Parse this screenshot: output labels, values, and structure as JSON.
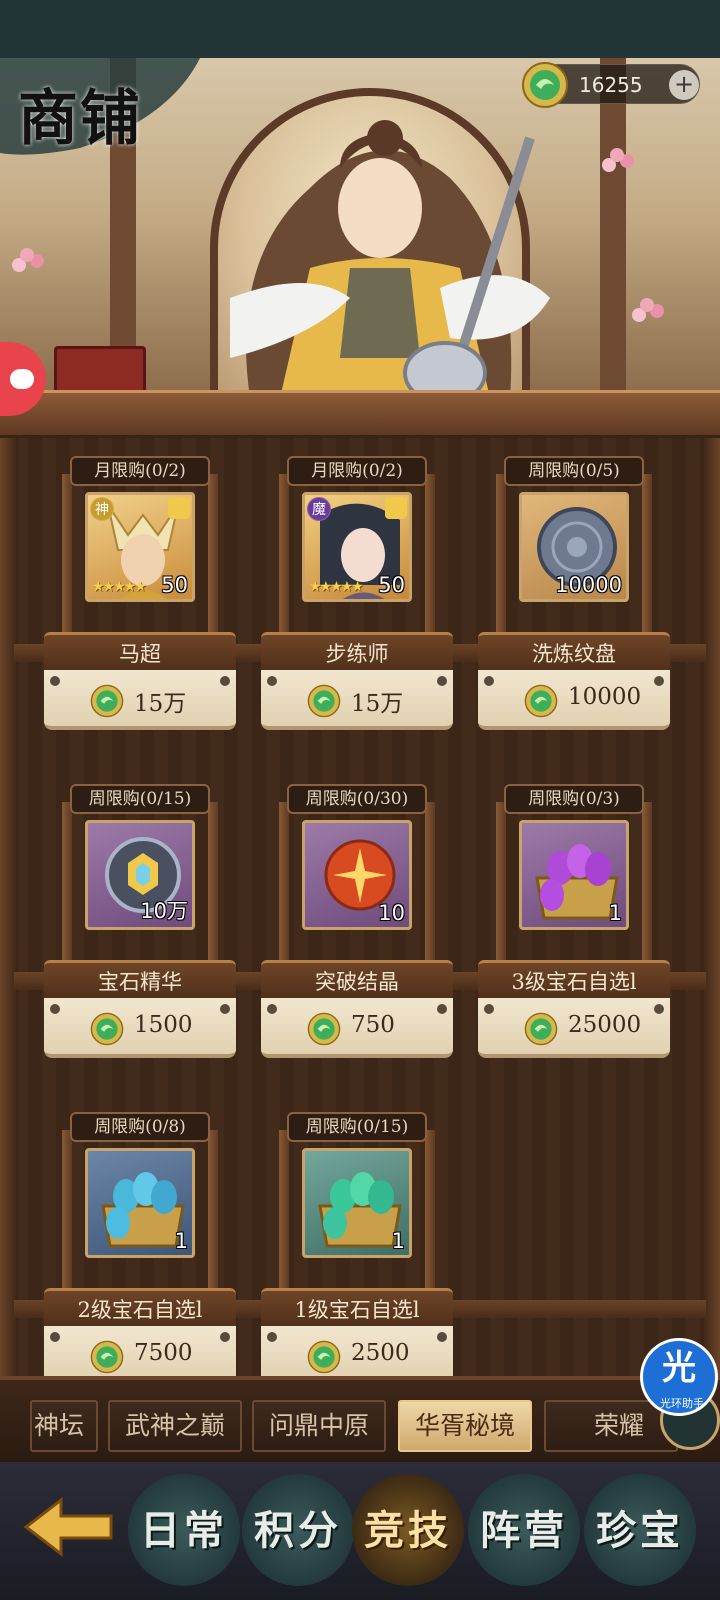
{
  "shop": {
    "title": "商铺"
  },
  "currency": {
    "amount": "16255",
    "icon": "jade-coin-icon"
  },
  "items": [
    {
      "limit": "月限购(0/2)",
      "name": "马超",
      "qty": "50",
      "price": "15万",
      "icon": "hero-ma-chao-portrait",
      "faction": "神"
    },
    {
      "limit": "月限购(0/2)",
      "name": "步练师",
      "qty": "50",
      "price": "15万",
      "icon": "hero-bu-lianshi-portrait",
      "faction": "魔"
    },
    {
      "limit": "周限购(0/5)",
      "name": "洗炼纹盘",
      "qty": "10000",
      "price": "10000",
      "icon": "refine-disc-icon"
    },
    {
      "limit": "周限购(0/15)",
      "name": "宝石精华",
      "qty": "10万",
      "price": "1500",
      "icon": "gem-essence-icon"
    },
    {
      "limit": "周限购(0/30)",
      "name": "突破结晶",
      "qty": "10",
      "price": "750",
      "icon": "breakthrough-crystal-icon"
    },
    {
      "limit": "周限购(0/3)",
      "name": "3级宝石自选l",
      "qty": "1",
      "price": "25000",
      "icon": "gem-chest-purple-icon"
    },
    {
      "limit": "周限购(0/8)",
      "name": "2级宝石自选l",
      "qty": "1",
      "price": "7500",
      "icon": "gem-chest-blue-icon"
    },
    {
      "limit": "周限购(0/15)",
      "name": "1级宝石自选l",
      "qty": "1",
      "price": "2500",
      "icon": "gem-chest-green-icon"
    }
  ],
  "tabs": [
    {
      "label": "神坛"
    },
    {
      "label": "武神之巅"
    },
    {
      "label": "问鼎中原"
    },
    {
      "label": "华胥秘境"
    },
    {
      "label": "荣耀"
    }
  ],
  "nav": [
    {
      "label": "日常"
    },
    {
      "label": "积分"
    },
    {
      "label": "竞技"
    },
    {
      "label": "阵营"
    },
    {
      "label": "珍宝"
    }
  ],
  "assistant": {
    "glyph": "光",
    "label": "光环助手"
  },
  "colors": {
    "active_tab": "#e8c889",
    "price_bg": "#f1e6cf",
    "assist_blue": "#1d6fd6"
  }
}
